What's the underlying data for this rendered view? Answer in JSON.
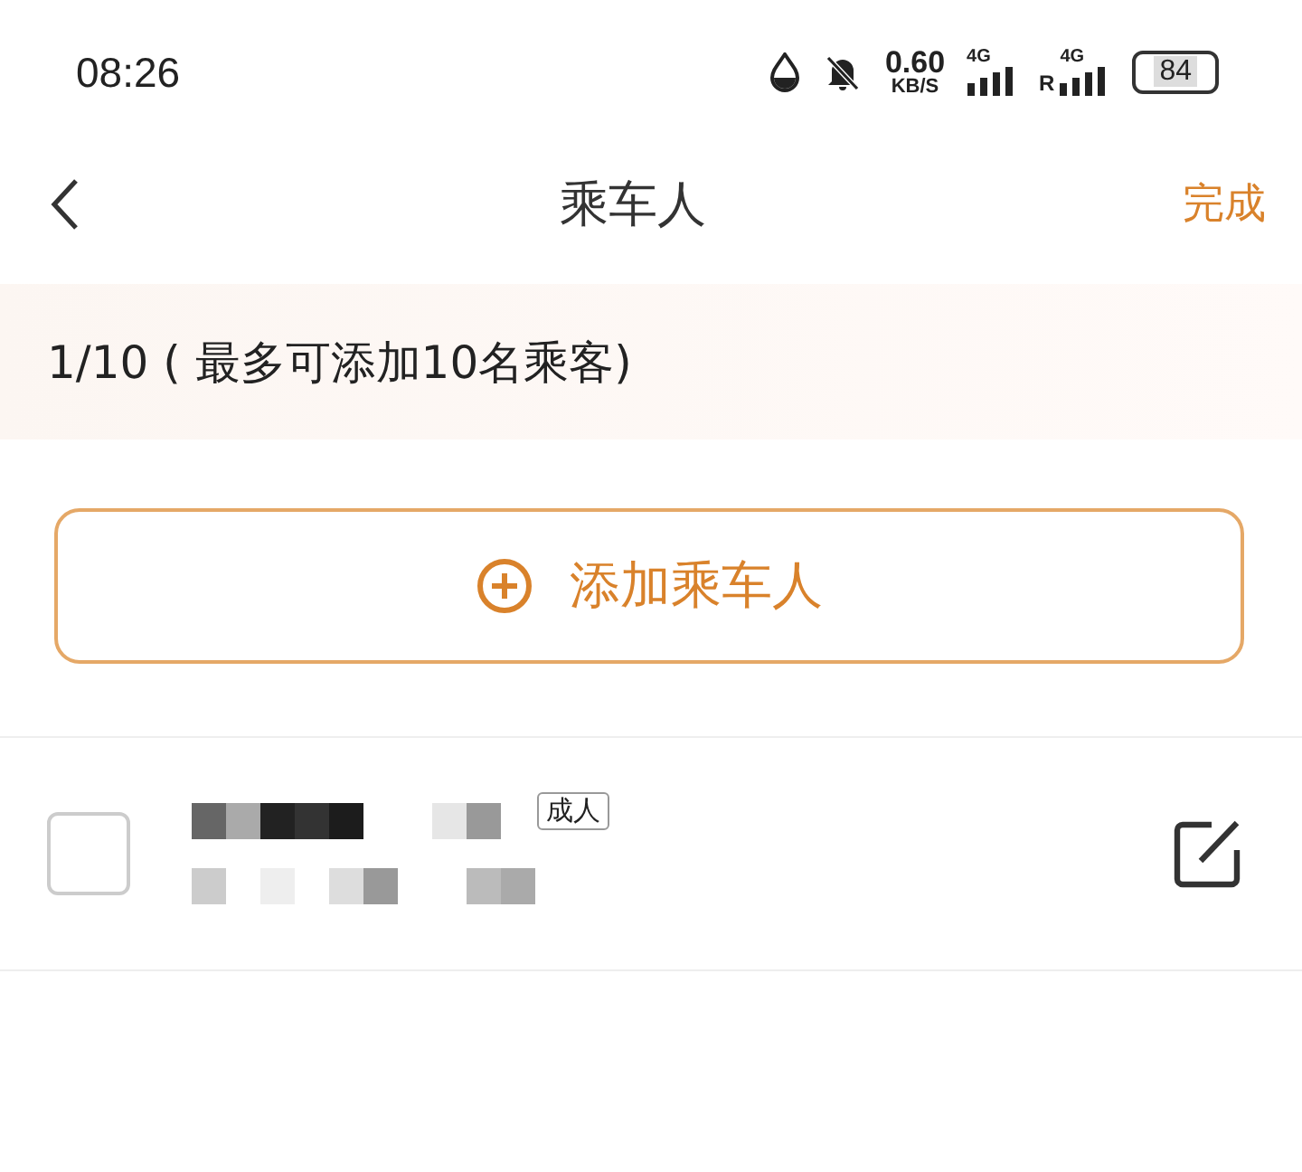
{
  "status_bar": {
    "time": "08:26",
    "speed": "0.60",
    "speed_unit": "KB/S",
    "networks": [
      {
        "label": "4G"
      },
      {
        "label": "4G",
        "roaming": "R"
      }
    ],
    "battery": "84"
  },
  "nav": {
    "title": "乘车人",
    "action": "完成"
  },
  "counter": "1/10 ( 最多可添加10名乘客)",
  "add_button": {
    "label": "添加乘车人"
  },
  "passengers": [
    {
      "checked": false,
      "tag": "成人"
    }
  ]
}
